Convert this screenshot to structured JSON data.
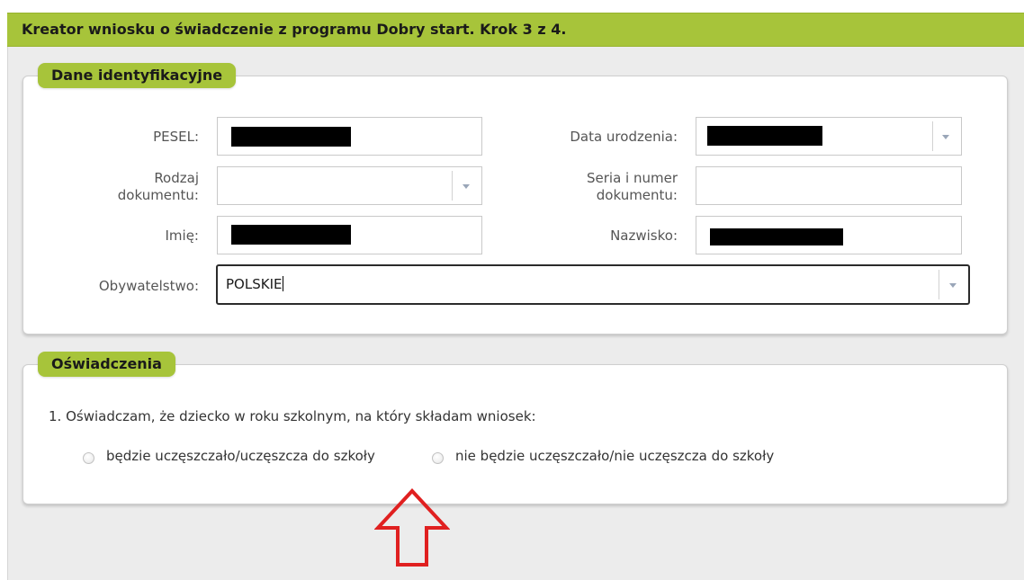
{
  "header": {
    "title": "Kreator wniosku o świadczenie z programu Dobry start. Krok 3 z 4."
  },
  "identification_panel": {
    "title": "Dane identyfikacyjne",
    "fields": {
      "pesel": {
        "label": "PESEL:",
        "value_redacted": true
      },
      "birth_date": {
        "label": "Data urodzenia:",
        "value_redacted": true
      },
      "document_type": {
        "label_line1": "Rodzaj",
        "label_line2": "dokumentu:",
        "value": ""
      },
      "document_number": {
        "label_line1": "Seria i numer",
        "label_line2": "dokumentu:",
        "value": ""
      },
      "first_name": {
        "label": "Imię:",
        "value_redacted": true
      },
      "last_name": {
        "label": "Nazwisko:",
        "value_redacted": true
      },
      "citizenship": {
        "label": "Obywatelstwo:",
        "value": "POLSKIE"
      }
    }
  },
  "statements_panel": {
    "title": "Oświadczenia",
    "statement_1": {
      "text": "1. Oświadczam, że dziecko w roku szkolnym, na który składam wniosek:",
      "options": [
        {
          "label": "będzie uczęszczało/uczęszcza do szkoły",
          "selected": false
        },
        {
          "label": "nie będzie uczęszczało/nie uczęszcza do szkoły",
          "selected": false
        }
      ]
    }
  },
  "annotation": {
    "arrow_color": "#e02020",
    "arrow_icon": "up-arrow-outline"
  },
  "colors": {
    "accent_green": "#a7c43a",
    "background_gray": "#ececec"
  }
}
